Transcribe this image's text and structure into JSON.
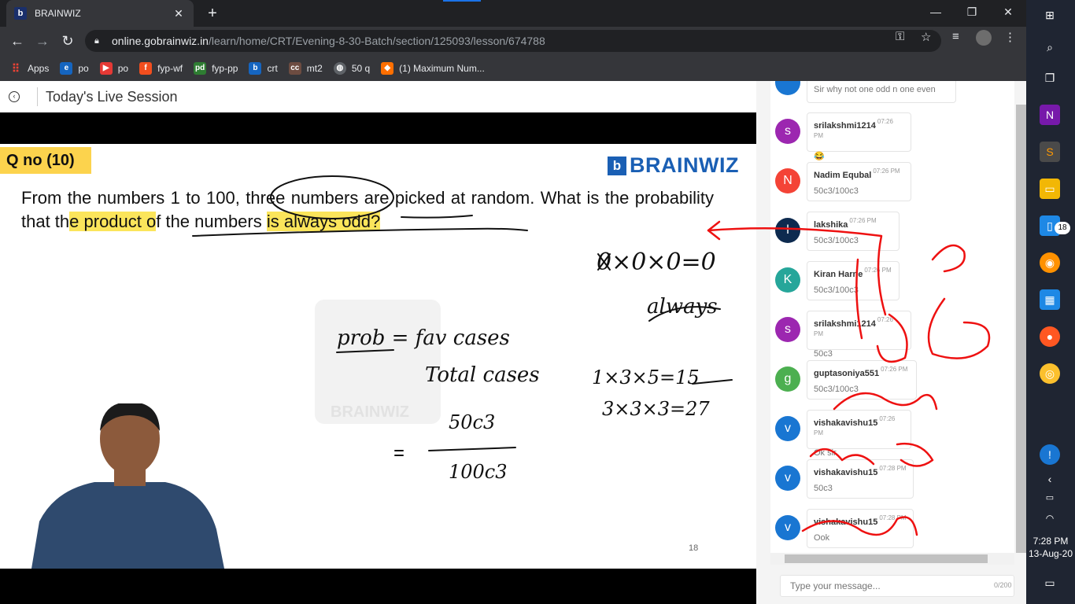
{
  "browser": {
    "tab_title": "BRAINWIZ",
    "tab_favicon": "b",
    "url_host": "online.gobrainwiz.in",
    "url_path": "/learn/home/CRT/Evening-8-30-Batch/section/125093/lesson/674788",
    "window_controls": {
      "minimize": "—",
      "maximize": "❐",
      "close": "✕"
    },
    "bookmarks": [
      {
        "label": "Apps",
        "icon": "apps-grid-icon",
        "color": "#ea4335"
      },
      {
        "label": "po",
        "icon": "e-icon",
        "color": "#1565c0"
      },
      {
        "label": "po",
        "icon": "youtube-icon",
        "color": "#e53935"
      },
      {
        "label": "fyp-wf",
        "icon": "figma-icon",
        "color": "#f24e1e"
      },
      {
        "label": "fyp-pp",
        "icon": "pd-icon",
        "color": "#2e7d32"
      },
      {
        "label": "crt",
        "icon": "brainwiz-icon",
        "color": "#1565c0"
      },
      {
        "label": "mt2",
        "icon": "cc-icon",
        "color": "#6d4c41"
      },
      {
        "label": "50 q",
        "icon": "globe-icon",
        "color": "#5f6368"
      },
      {
        "label": "(1) Maximum Num...",
        "icon": "site-icon",
        "color": "#ff6f00"
      }
    ]
  },
  "page": {
    "header_title": "Today's Live Session"
  },
  "slide": {
    "qno": "Q no (10)",
    "logo_text": "BRAINWIZ",
    "logo_mark": "b",
    "question_part1": "From the numbers 1 to 100, three numbers are picked at random. What is the probability that th",
    "question_hl1": "e product o",
    "question_part2": "f the numbers ",
    "question_hl2": "is always odd?",
    "watermark_text": "BRAINWIZ",
    "page_number": "18"
  },
  "chat": {
    "top_snippet": "Sir why not one odd n one even",
    "messages": [
      {
        "initial": "s",
        "color": "#9c27b0",
        "name": "srilakshmi1214",
        "time": "07:26 PM",
        "text": "😂"
      },
      {
        "initial": "N",
        "color": "#f44336",
        "name": "Nadim Equbal",
        "time": "07:26 PM",
        "text": "50c3/100c3"
      },
      {
        "initial": "l",
        "color": "#0d2a4f",
        "name": "lakshika",
        "time": "07:26 PM",
        "text": "50c3/100c3"
      },
      {
        "initial": "K",
        "color": "#26a69a",
        "name": "Kiran Harne",
        "time": "07:26 PM",
        "text": "50c3/100c3"
      },
      {
        "initial": "s",
        "color": "#9c27b0",
        "name": "srilakshmi1214",
        "time": "07:26 PM",
        "text": "50c3"
      },
      {
        "initial": "g",
        "color": "#4caf50",
        "name": "guptasoniya551",
        "time": "07:26 PM",
        "text": "50c3/100c3"
      },
      {
        "initial": "v",
        "color": "#1976d2",
        "name": "vishakavishu15",
        "time": "07:26 PM",
        "text": "Ok sir"
      },
      {
        "initial": "v",
        "color": "#1976d2",
        "name": "vishakavishu15",
        "time": "07:28 PM",
        "text": "50c3"
      },
      {
        "initial": "v",
        "color": "#1976d2",
        "name": "vishakavishu15",
        "time": "07:28 PM",
        "text": "Ook"
      }
    ],
    "input_placeholder": "Type your message...",
    "char_count": "0/200"
  },
  "taskbar": {
    "time": "7:28 PM",
    "date": "13-Aug-20",
    "badge_count": "18",
    "icons": [
      "windows-start-icon",
      "search-icon",
      "task-view-icon",
      "onenote-icon",
      "sublime-icon",
      "file-explorer-icon",
      "phone-icon",
      "media-player-icon",
      "calculator-icon",
      "firefox-icon",
      "chrome-icon"
    ]
  }
}
